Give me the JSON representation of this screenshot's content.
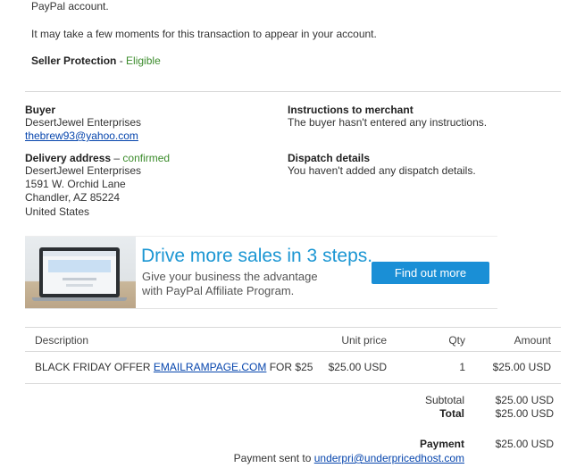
{
  "top": {
    "account_line": "PayPal account.",
    "notice": "It may take a few moments for this transaction to appear in your account.",
    "seller_protection_label": "Seller Protection",
    "seller_protection_sep": " - ",
    "seller_protection_status": "Eligible"
  },
  "buyer": {
    "heading": "Buyer",
    "name": "DesertJewel Enterprises",
    "email": "thebrew93@yahoo.com"
  },
  "delivery": {
    "heading": "Delivery address",
    "sep": " – ",
    "status": "confirmed",
    "lines": [
      "DesertJewel Enterprises",
      "1591 W. Orchid Lane",
      "Chandler, AZ 85224",
      "United States"
    ]
  },
  "instructions": {
    "heading": "Instructions to merchant",
    "text": "The buyer hasn't entered any instructions."
  },
  "dispatch": {
    "heading": "Dispatch details",
    "text": "You haven't added any dispatch details."
  },
  "banner": {
    "headline": "Drive more sales in 3 steps.",
    "sub_line1": "Give your business the advantage",
    "sub_line2": "with PayPal Affiliate Program.",
    "button": "Find out more",
    "image_icon": "laptop-illustration"
  },
  "table": {
    "headers": {
      "description": "Description",
      "unit_price": "Unit price",
      "qty": "Qty",
      "amount": "Amount"
    },
    "rows": [
      {
        "desc_pre": "BLACK FRIDAY OFFER ",
        "desc_link": "EMAILRAMPAGE.COM",
        "desc_post": " FOR $25",
        "unit_price": "$25.00 USD",
        "qty": "1",
        "amount": "$25.00 USD"
      }
    ]
  },
  "totals": {
    "subtotal_label": "Subtotal",
    "subtotal_value": "$25.00 USD",
    "total_label": "Total",
    "total_value": "$25.00 USD",
    "payment_label": "Payment",
    "payment_value": "$25.00 USD",
    "payment_sent_prefix": "Payment sent to ",
    "payment_sent_email": "underpri@underpricedhost.com"
  },
  "colors": {
    "link": "#0645ad",
    "eligible_green": "#3c8c2c",
    "banner_blue": "#1b96d3",
    "button_blue": "#1a8fd6"
  }
}
